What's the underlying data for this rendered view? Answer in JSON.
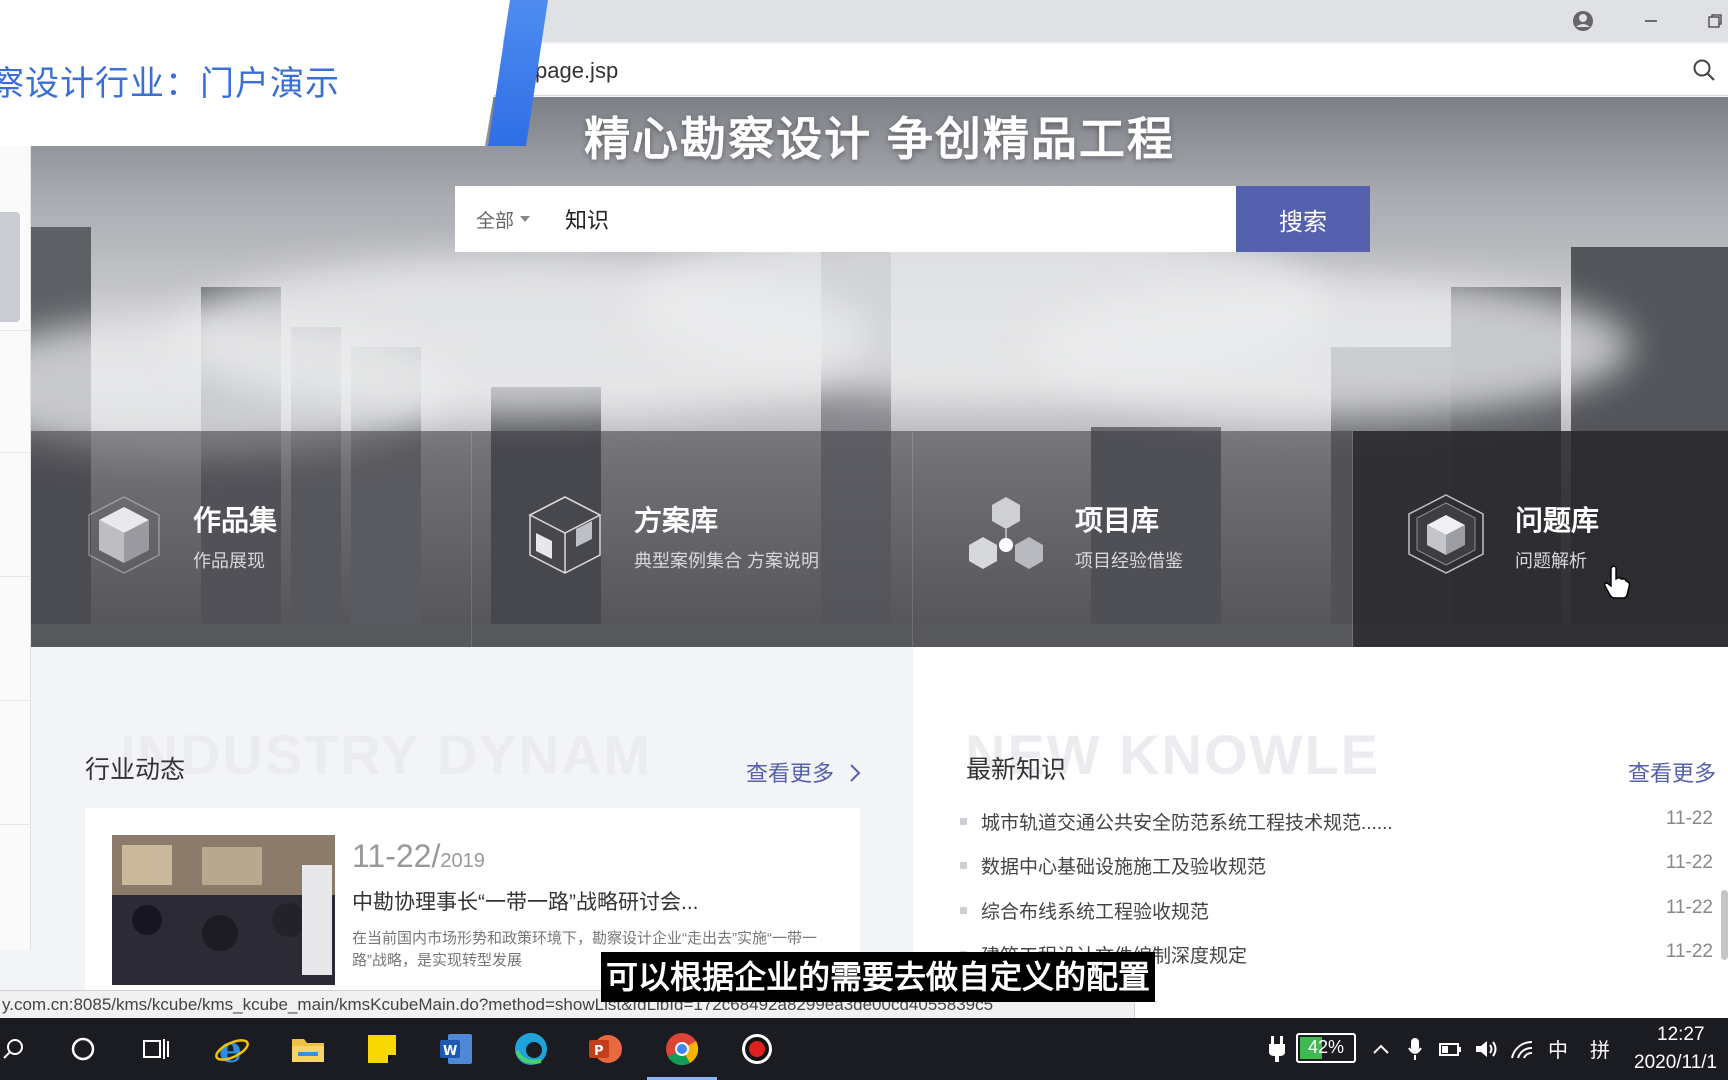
{
  "browser": {
    "address_fragment": "page.jsp",
    "status_url": "y.com.cn:8085/kms/kcube/kms_kcube_main/kmsKcubeMain.do?method=showList&fdLibId=172c68492a8299ea3de00cd4055839c5"
  },
  "overlay": {
    "title": "察设计行业：门户演示"
  },
  "hero": {
    "slogan": "精心勘察设计 争创精品工程",
    "search": {
      "scope": "全部",
      "query": "知识",
      "button": "搜索"
    },
    "categories": [
      {
        "title": "作品集",
        "subtitle": "作品展现",
        "icon": "cube-icon"
      },
      {
        "title": "方案库",
        "subtitle": "典型案例集合 方案说明",
        "icon": "box-outline-icon"
      },
      {
        "title": "项目库",
        "subtitle": "项目经验借鉴",
        "icon": "cluster-icon"
      },
      {
        "title": "问题库",
        "subtitle": "问题解析",
        "icon": "hexagon-cube-icon"
      }
    ]
  },
  "industry": {
    "title": "行业动态",
    "watermark": "INDUSTRY DYNAM",
    "more": "查看更多",
    "news": {
      "date": "11-22/",
      "year": "2019",
      "title": "中勘协理事长“一带一路”战略研讨会...",
      "desc": "在当前国内市场形势和政策环境下，勘察设计企业“走出去”实施“一带一路”战略，是实现转型发展"
    }
  },
  "knowledge": {
    "title": "最新知识",
    "watermark": "NEW KNOWLE",
    "more": "查看更多",
    "items": [
      {
        "text": "城市轨道交通公共安全防范系统工程技术规范......",
        "date": "11-22"
      },
      {
        "text": "数据中心基础设施施工及验收规范",
        "date": "11-22"
      },
      {
        "text": "综合布线系统工程验收规范",
        "date": "11-22"
      },
      {
        "text": "建筑工程设计文件编制深度规定",
        "date": "11-22"
      }
    ]
  },
  "subtitle": "可以根据企业的需要去做自定义的配置",
  "taskbar": {
    "battery": "42%",
    "ime": "中",
    "ime2": "拼",
    "time": "12:27",
    "date": "2020/11/1"
  },
  "colors": {
    "accent": "#5561ae",
    "title_blue": "#3a6fd8",
    "taskbar": "#1b1c22"
  }
}
